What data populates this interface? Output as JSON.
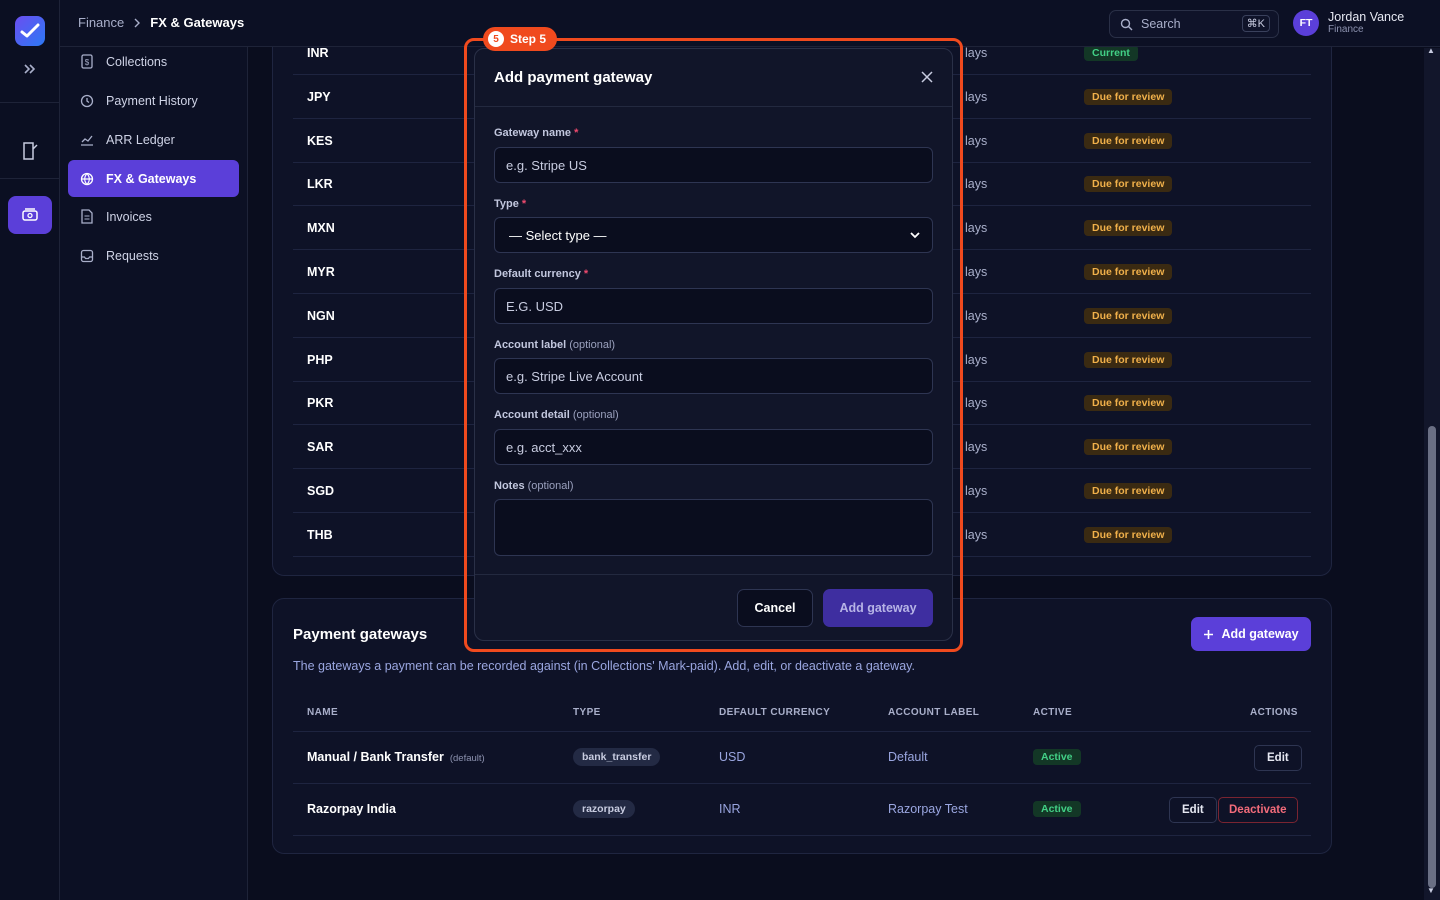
{
  "breadcrumb": {
    "root": "Finance",
    "current": "FX & Gateways"
  },
  "search": {
    "label": "Search",
    "shortcut": "⌘K"
  },
  "user": {
    "initials": "FT",
    "name": "Jordan Vance",
    "role": "Finance"
  },
  "sidebar": {
    "items": [
      {
        "label": "Collections",
        "icon": "dollar-doc-icon"
      },
      {
        "label": "Payment History",
        "icon": "history-icon"
      },
      {
        "label": "ARR Ledger",
        "icon": "chart-line-icon"
      },
      {
        "label": "FX & Gateways",
        "icon": "globe-icon",
        "active": true
      },
      {
        "label": "Invoices",
        "icon": "invoice-icon"
      },
      {
        "label": "Requests",
        "icon": "inbox-icon"
      }
    ]
  },
  "fx_rows": [
    {
      "code": "INR",
      "days": "lays",
      "status": "Current"
    },
    {
      "code": "JPY",
      "days": "lays",
      "status": "Due for review"
    },
    {
      "code": "KES",
      "days": "lays",
      "status": "Due for review"
    },
    {
      "code": "LKR",
      "days": "lays",
      "status": "Due for review"
    },
    {
      "code": "MXN",
      "days": "lays",
      "status": "Due for review"
    },
    {
      "code": "MYR",
      "days": "lays",
      "status": "Due for review"
    },
    {
      "code": "NGN",
      "days": "lays",
      "status": "Due for review"
    },
    {
      "code": "PHP",
      "days": "lays",
      "status": "Due for review"
    },
    {
      "code": "PKR",
      "days": "lays",
      "status": "Due for review"
    },
    {
      "code": "SAR",
      "days": "lays",
      "status": "Due for review"
    },
    {
      "code": "SGD",
      "days": "lays",
      "status": "Due for review"
    },
    {
      "code": "THB",
      "days": "lays",
      "status": "Due for review"
    }
  ],
  "gateways": {
    "title": "Payment gateways",
    "description": "The gateways a payment can be recorded against (in Collections' Mark-paid). Add, edit, or deactivate a gateway.",
    "add_label": "Add gateway",
    "columns": {
      "name": "NAME",
      "type": "TYPE",
      "currency": "DEFAULT CURRENCY",
      "account": "ACCOUNT LABEL",
      "active": "ACTIVE",
      "actions": "ACTIONS"
    },
    "rows": [
      {
        "name": "Manual / Bank Transfer",
        "tag": "(default)",
        "type": "bank_transfer",
        "currency": "USD",
        "account": "Default",
        "active": "Active",
        "edit": "Edit"
      },
      {
        "name": "Razorpay India",
        "tag": "",
        "type": "razorpay",
        "currency": "INR",
        "account": "Razorpay Test",
        "active": "Active",
        "edit": "Edit",
        "deactivate": "Deactivate"
      }
    ]
  },
  "step": {
    "number": "5",
    "label": "Step 5"
  },
  "modal": {
    "title": "Add payment gateway",
    "fields": {
      "name": {
        "label": "Gateway name",
        "required": "*",
        "placeholder": "e.g. Stripe US"
      },
      "type": {
        "label": "Type",
        "required": "*",
        "value": "— Select type —"
      },
      "currency": {
        "label": "Default currency",
        "required": "*",
        "placeholder": "E.G. USD"
      },
      "account_label": {
        "label": "Account label",
        "optional": "(optional)",
        "placeholder": "e.g. Stripe Live Account"
      },
      "account_detail": {
        "label": "Account detail",
        "optional": "(optional)",
        "placeholder": "e.g. acct_xxx"
      },
      "notes": {
        "label": "Notes",
        "optional": "(optional)",
        "placeholder": ""
      }
    },
    "cancel_label": "Cancel",
    "submit_label": "Add gateway"
  },
  "colors": {
    "accent": "#5b3fd9",
    "highlight": "#f04a1e",
    "warning": "#f0b04a",
    "success": "#42d086",
    "danger": "#f26b7a"
  }
}
